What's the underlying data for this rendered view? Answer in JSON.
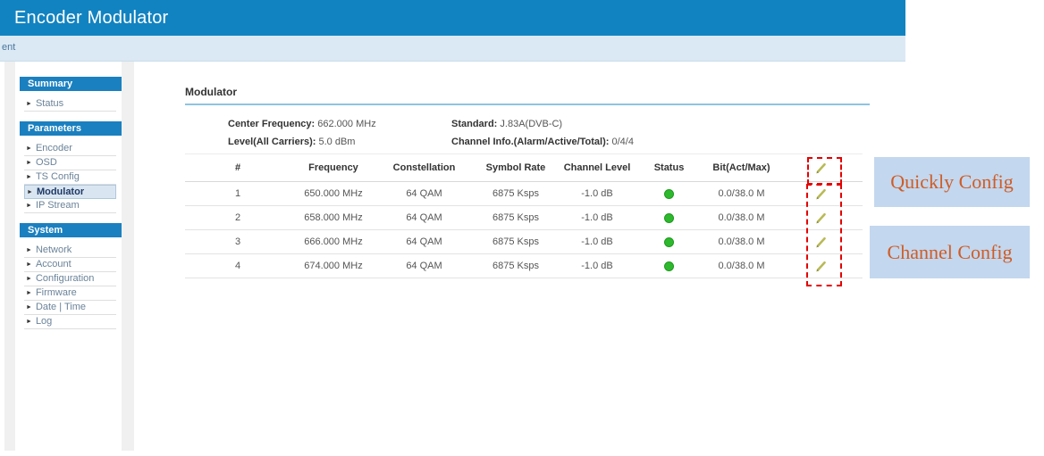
{
  "header": {
    "title": "Encoder Modulator",
    "subbar_text": "ent"
  },
  "sidebar": {
    "sections": [
      {
        "title": "Summary",
        "items": [
          {
            "label": "Status",
            "selected": false
          }
        ]
      },
      {
        "title": "Parameters",
        "items": [
          {
            "label": "Encoder",
            "selected": false
          },
          {
            "label": "OSD",
            "selected": false
          },
          {
            "label": "TS Config",
            "selected": false
          },
          {
            "label": "Modulator",
            "selected": true
          },
          {
            "label": "IP Stream",
            "selected": false
          }
        ]
      },
      {
        "title": "System",
        "items": [
          {
            "label": "Network",
            "selected": false
          },
          {
            "label": "Account",
            "selected": false
          },
          {
            "label": "Configuration",
            "selected": false
          },
          {
            "label": "Firmware",
            "selected": false
          },
          {
            "label": "Date | Time",
            "selected": false
          },
          {
            "label": "Log",
            "selected": false
          }
        ]
      }
    ]
  },
  "main": {
    "title": "Modulator",
    "info": [
      {
        "label": "Center Frequency:",
        "value": "662.000 MHz"
      },
      {
        "label": "Standard:",
        "value": "J.83A(DVB-C)"
      },
      {
        "label": "Level(All Carriers):",
        "value": "5.0 dBm"
      },
      {
        "label": "Channel Info.(Alarm/Active/Total):",
        "value": "0/4/4"
      }
    ],
    "table": {
      "columns": [
        "#",
        "Frequency",
        "Constellation",
        "Symbol Rate",
        "Channel Level",
        "Status",
        "Bit(Act/Max)"
      ],
      "rows": [
        {
          "num": "1",
          "frequency": "650.000 MHz",
          "constellation": "64 QAM",
          "symbol_rate": "6875 Ksps",
          "channel_level": "-1.0 dB",
          "status": "ok",
          "bit": "0.0/38.0 M"
        },
        {
          "num": "2",
          "frequency": "658.000 MHz",
          "constellation": "64 QAM",
          "symbol_rate": "6875 Ksps",
          "channel_level": "-1.0 dB",
          "status": "ok",
          "bit": "0.0/38.0 M"
        },
        {
          "num": "3",
          "frequency": "666.000 MHz",
          "constellation": "64 QAM",
          "symbol_rate": "6875 Ksps",
          "channel_level": "-1.0 dB",
          "status": "ok",
          "bit": "0.0/38.0 M"
        },
        {
          "num": "4",
          "frequency": "674.000 MHz",
          "constellation": "64 QAM",
          "symbol_rate": "6875 Ksps",
          "channel_level": "-1.0 dB",
          "status": "ok",
          "bit": "0.0/38.0 M"
        }
      ]
    }
  },
  "annotations": {
    "quickly_config_label": "Quickly Config",
    "channel_config_label": "Channel Config"
  },
  "icons": {
    "edit": "pencil-icon",
    "status": "green-dot-icon",
    "menu_bullet": "triangle-right-icon"
  },
  "colors": {
    "header_blue": "#1283c1",
    "subbar_blue": "#dbe9f4",
    "section_blue": "#1b80bf",
    "status_green": "#2eb82e",
    "pencil_olive": "#b9ba57",
    "annotation_bg": "#c3d7ee",
    "annotation_text": "#cf5c26",
    "highlight_red": "#e60000"
  }
}
